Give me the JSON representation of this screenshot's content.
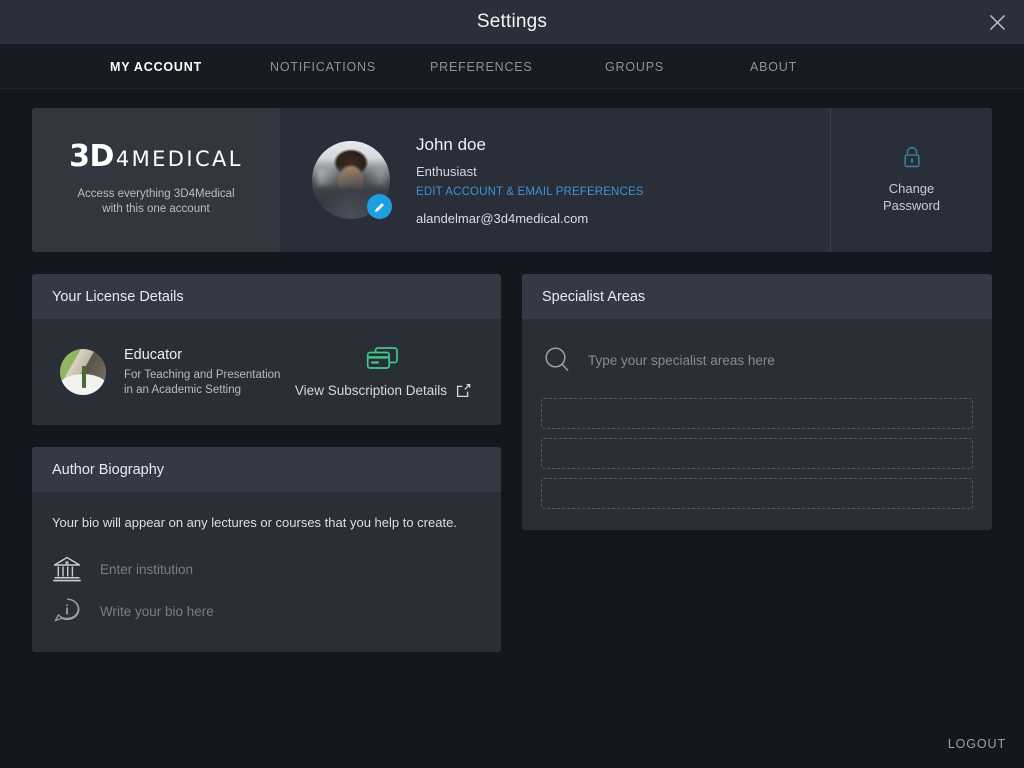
{
  "window": {
    "title": "Settings",
    "close_icon": "close-icon"
  },
  "tabs": [
    {
      "label": "MY ACCOUNT",
      "active": true
    },
    {
      "label": "NOTIFICATIONS",
      "active": false
    },
    {
      "label": "PREFERENCES",
      "active": false
    },
    {
      "label": "GROUPS",
      "active": false
    },
    {
      "label": "ABOUT",
      "active": false
    }
  ],
  "brand": {
    "logo_bold": "3D",
    "logo_light": "4MEDICAL",
    "tagline_line1": "Access everything 3D4Medical",
    "tagline_line2": "with this one account"
  },
  "profile": {
    "avatar_icon": "user-avatar",
    "edit_avatar_icon": "pencil-icon",
    "name": "John doe",
    "role": "Enthusiast",
    "edit_link": "EDIT ACCOUNT & EMAIL PREFERENCES",
    "email": "alandelmar@3d4medical.com"
  },
  "change_password": {
    "lock_icon": "lock-icon",
    "label_line1": "Change",
    "label_line2": "Password",
    "icon_color": "#2f7f9b"
  },
  "license": {
    "card_title": "Your License Details",
    "badge_icon": "license-badge-icon",
    "name": "Educator",
    "desc_line1": "For Teaching and Presentation",
    "desc_line2": "in an Academic Setting",
    "card_icon": "credit-card-icon",
    "card_icon_color": "#3ec98a",
    "subscription_label": "View Subscription Details",
    "external_link_icon": "external-link-icon"
  },
  "biography": {
    "card_title": "Author Biography",
    "description": "Your bio will appear on any lectures or courses that you help to create.",
    "institution_icon": "institution-icon",
    "institution_placeholder": "Enter institution",
    "bio_icon": "info-bubble-icon",
    "bio_placeholder": "Write your bio here"
  },
  "specialist": {
    "card_title": "Specialist Areas",
    "search_icon": "search-icon",
    "search_placeholder": "Type your specialist areas here",
    "slots": [
      "",
      "",
      ""
    ]
  },
  "footer": {
    "logout_label": "LOGOUT"
  },
  "colors": {
    "page_background": "#14171e",
    "card_background": "#2a2e37",
    "card_header": "#343945",
    "accent_link": "#3e93d4",
    "accent_green": "#3ec98a",
    "accent_teal": "#2f7f9b",
    "avatar_edit_blue": "#1e9fe0"
  }
}
